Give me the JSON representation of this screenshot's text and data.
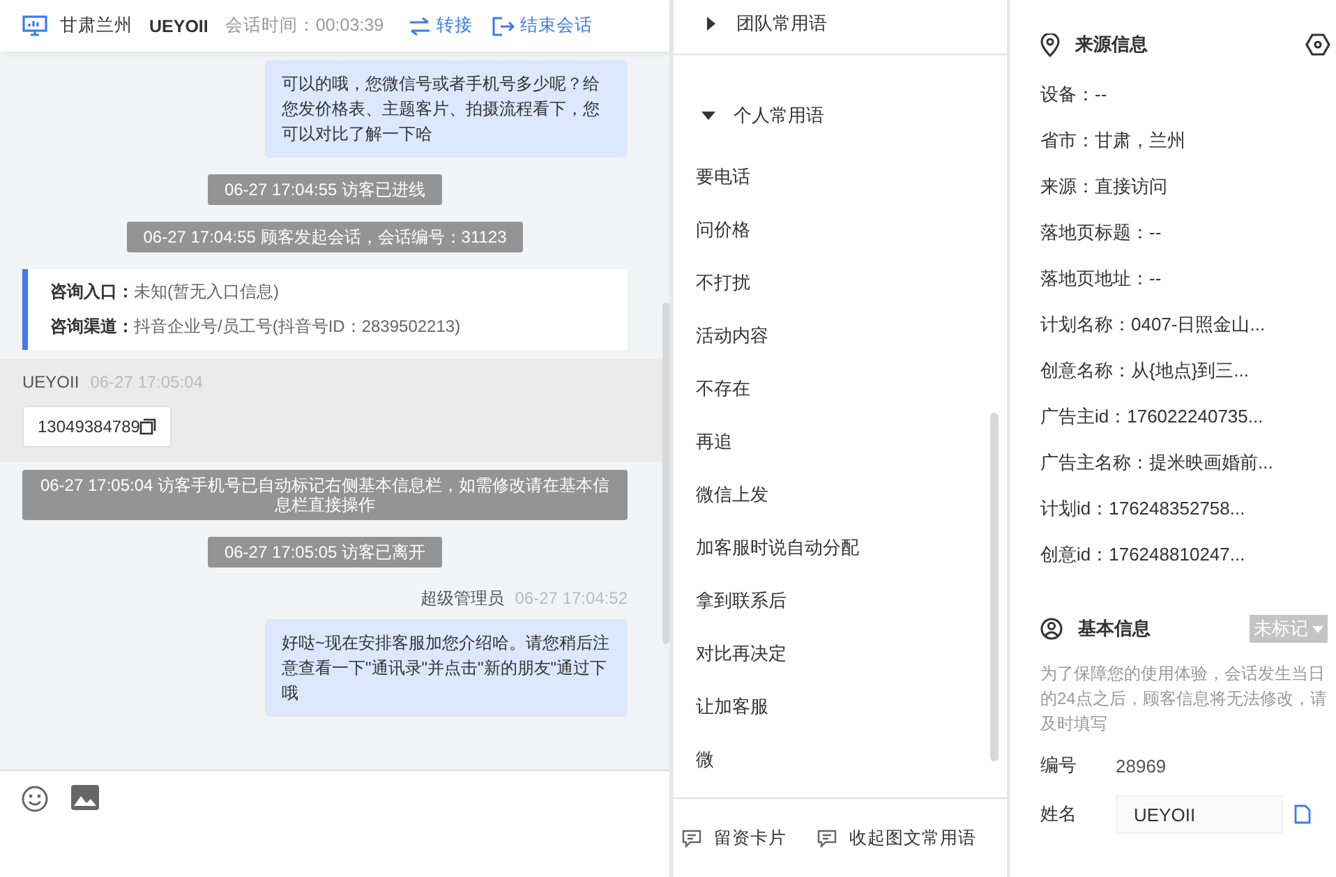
{
  "header": {
    "location": "甘肃兰州",
    "visitor": "UEYOII",
    "session_time": "会话时间：00:03:39",
    "actions": [
      {
        "kind": "transfer",
        "label": "转接"
      },
      {
        "kind": "end",
        "label": "结束会话"
      }
    ]
  },
  "messages": [
    {
      "kind": "agent",
      "text": "可以的哦，您微信号或者手机号多少呢？给您发价格表、主题客片、拍摄流程看下，您可以对比了解一下哈"
    },
    {
      "kind": "system",
      "text": "06-27 17:04:55 访客已进线"
    },
    {
      "kind": "system",
      "text": "06-27 17:04:55 顾客发起会话，会话编号：31123"
    },
    {
      "kind": "entry",
      "rows": [
        {
          "label": "咨询入口：",
          "value": "未知(暂无入口信息)"
        },
        {
          "label": "咨询渠道：",
          "value": "抖音企业号/员工号(抖音号ID：2839502213)"
        }
      ]
    },
    {
      "kind": "visitor",
      "name": "UEYOII",
      "time": "06-27 17:05:04",
      "text": "13049384789"
    },
    {
      "kind": "system",
      "text": "06-27 17:05:04 访客手机号已自动标记右侧基本信息栏，如需修改请在基本信息栏直接操作"
    },
    {
      "kind": "system",
      "text": "06-27 17:05:05 访客已离开"
    },
    {
      "kind": "agent",
      "name": "超级管理员",
      "time": "06-27 17:04:52",
      "text": "好哒~现在安排客服加您介绍哈。请您稍后注意查看一下\"通讯录\"并点击\"新的朋友\"通过下哦"
    }
  ],
  "phrases": {
    "groups": [
      {
        "label": "团队常用语",
        "expanded": false
      },
      {
        "label": "个人常用语",
        "expanded": true
      }
    ],
    "items": [
      "要电话",
      "问价格",
      "不打扰",
      "活动内容",
      "不存在",
      "再追",
      "微信上发",
      "加客服时说自动分配",
      "拿到联系后",
      "对比再决定",
      "让加客服",
      "微"
    ],
    "footer": [
      "留资卡片",
      "收起图文常用语"
    ]
  },
  "source": {
    "title": "来源信息",
    "fields": [
      "设备：--",
      "省市：甘肃，兰州",
      "来源：直接访问",
      "落地页标题：--",
      "落地页地址：--",
      "计划名称：0407-日照金山...",
      "创意名称：从{地点}到三...",
      "广告主id：176022240735...",
      "广告主名称：提米映画婚前...",
      "计划id：176248352758...",
      "创意id：176248810247..."
    ]
  },
  "basic": {
    "title": "基本信息",
    "tag": "未标记",
    "notice": "为了保障您的使用体验，会话发生当日的24点之后，顾客信息将无法修改，请及时填写",
    "fields": [
      {
        "kind": "text",
        "label": "编号",
        "value": "28969"
      },
      {
        "kind": "input",
        "label": "姓名",
        "value": "UEYOII"
      }
    ]
  }
}
